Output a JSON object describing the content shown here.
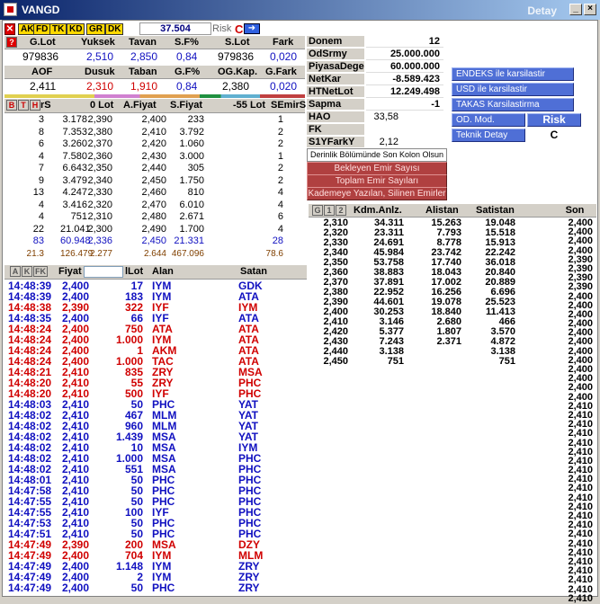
{
  "window": {
    "title": "VANGD",
    "subtitle": "Detay"
  },
  "toolbar": {
    "tags": [
      "AK",
      "FD",
      "TK",
      "KD",
      "GR",
      "DK"
    ],
    "price": "37.504",
    "risk_label": "Risk",
    "risk_value": "C"
  },
  "summary": {
    "h1": [
      "G.Lot",
      "Yuksek",
      "Tavan",
      "S.F%",
      "S.Lot",
      "Fark"
    ],
    "v1": [
      "979836",
      "2,510",
      "2,850",
      "0,84",
      "979836",
      "0,020"
    ],
    "h2": [
      "AOF",
      "Dusuk",
      "Taban",
      "G.F%",
      "OG.Kap.",
      "G.Fark"
    ],
    "v2": [
      "2,411",
      "2,310",
      "1,910",
      "0,84",
      "2,380",
      "0,020"
    ]
  },
  "depth": {
    "tabs": [
      "B",
      "T",
      "H"
    ],
    "headers": [
      "rS",
      "0 Lot",
      "A.Fiyat",
      "S.Fiyat",
      "-55 Lot",
      "SEmirS"
    ],
    "rows": [
      [
        "3",
        "3.178",
        "2,390",
        "2,400",
        "233",
        "1"
      ],
      [
        "8",
        "7.353",
        "2,380",
        "2,410",
        "3.792",
        "2"
      ],
      [
        "6",
        "3.260",
        "2,370",
        "2,420",
        "1.060",
        "2"
      ],
      [
        "4",
        "7.580",
        "2,360",
        "2,430",
        "3.000",
        "1"
      ],
      [
        "7",
        "6.643",
        "2,350",
        "2,440",
        "305",
        "2"
      ],
      [
        "9",
        "3.479",
        "2,340",
        "2,450",
        "1.750",
        "2"
      ],
      [
        "13",
        "4.247",
        "2,330",
        "2,460",
        "810",
        "4"
      ],
      [
        "4",
        "3.416",
        "2,320",
        "2,470",
        "6.010",
        "4"
      ],
      [
        "4",
        "751",
        "2,310",
        "2,480",
        "2.671",
        "6"
      ],
      [
        "22",
        "21.041",
        "2,300",
        "2,490",
        "1.700",
        "4"
      ]
    ],
    "total": [
      "83",
      "60.948",
      "2,336",
      "2,450",
      "21.331",
      "28"
    ],
    "avg": [
      "21.3",
      "126.479",
      "2.277",
      "2.644",
      "467.096",
      "78.6"
    ]
  },
  "trades": {
    "tabs": [
      "A",
      "K",
      "FK"
    ],
    "headers": [
      "Fiyat",
      "lLot",
      "Alan",
      "Satan"
    ],
    "rows": [
      [
        "14:48:39",
        "2,400",
        "17",
        "IYM",
        "GDK",
        "b"
      ],
      [
        "14:48:39",
        "2,400",
        "183",
        "IYM",
        "ATA",
        "b"
      ],
      [
        "14:48:38",
        "2,390",
        "322",
        "IYF",
        "IYM",
        "r"
      ],
      [
        "14:48:35",
        "2,400",
        "66",
        "IYF",
        "ATA",
        "b"
      ],
      [
        "14:48:24",
        "2,400",
        "750",
        "ATA",
        "ATA",
        "r"
      ],
      [
        "14:48:24",
        "2,400",
        "1.000",
        "IYM",
        "ATA",
        "r"
      ],
      [
        "14:48:24",
        "2,400",
        "1",
        "AKM",
        "ATA",
        "r"
      ],
      [
        "14:48:24",
        "2,400",
        "1.000",
        "TAC",
        "ATA",
        "r"
      ],
      [
        "14:48:21",
        "2,410",
        "835",
        "ZRY",
        "MSA",
        "r"
      ],
      [
        "14:48:20",
        "2,410",
        "55",
        "ZRY",
        "PHC",
        "r"
      ],
      [
        "14:48:20",
        "2,410",
        "500",
        "IYF",
        "PHC",
        "r"
      ],
      [
        "14:48:03",
        "2,410",
        "50",
        "PHC",
        "YAT",
        "b"
      ],
      [
        "14:48:02",
        "2,410",
        "467",
        "MLM",
        "YAT",
        "b"
      ],
      [
        "14:48:02",
        "2,410",
        "960",
        "MLM",
        "YAT",
        "b"
      ],
      [
        "14:48:02",
        "2,410",
        "1.439",
        "MSA",
        "YAT",
        "b"
      ],
      [
        "14:48:02",
        "2,410",
        "10",
        "MSA",
        "IYM",
        "b"
      ],
      [
        "14:48:02",
        "2,410",
        "1.000",
        "MSA",
        "PHC",
        "b"
      ],
      [
        "14:48:02",
        "2,410",
        "551",
        "MSA",
        "PHC",
        "b"
      ],
      [
        "14:48:01",
        "2,410",
        "50",
        "PHC",
        "PHC",
        "b"
      ],
      [
        "14:47:58",
        "2,410",
        "50",
        "PHC",
        "PHC",
        "b"
      ],
      [
        "14:47:55",
        "2,410",
        "50",
        "PHC",
        "PHC",
        "b"
      ],
      [
        "14:47:55",
        "2,410",
        "100",
        "IYF",
        "PHC",
        "b"
      ],
      [
        "14:47:53",
        "2,410",
        "50",
        "PHC",
        "PHC",
        "b"
      ],
      [
        "14:47:51",
        "2,410",
        "50",
        "PHC",
        "PHC",
        "b"
      ],
      [
        "14:47:49",
        "2,390",
        "200",
        "MSA",
        "DZY",
        "r"
      ],
      [
        "14:47:49",
        "2,400",
        "704",
        "IYM",
        "MLM",
        "r"
      ],
      [
        "14:47:49",
        "2,400",
        "1.148",
        "IYM",
        "ZRY",
        "b"
      ],
      [
        "14:47:49",
        "2,400",
        "2",
        "IYM",
        "ZRY",
        "b"
      ],
      [
        "14:47:49",
        "2,400",
        "50",
        "PHC",
        "ZRY",
        "b"
      ]
    ]
  },
  "info": {
    "rows": [
      [
        "Donem",
        "12"
      ],
      [
        "OdSrmy",
        "25.000.000"
      ],
      [
        "PiyasaDege",
        "60.000.000"
      ],
      [
        "NetKar",
        "-8.589.423"
      ],
      [
        "HTNetLot",
        "12.249.498"
      ],
      [
        "Sapma",
        "-1"
      ]
    ],
    "hao_label": "HAO",
    "hao_value": "33,58",
    "fk_label": "FK",
    "fk_value": "",
    "s1y_label": "S1YFarkY",
    "s1y_value": "2,12"
  },
  "actions": {
    "endeks": "ENDEKS ile karsilastir",
    "usd": "USD ile karsilastir",
    "takas": "TAKAS Karsilastirma",
    "od_mod": "OD. Mod.",
    "risk_kodu_label": "Risk Kodu",
    "teknik": "Teknik Detay",
    "risk_kodu_value": "C"
  },
  "options": {
    "depth_note": "Derinlik Bölümünde Son Kolon Olsun",
    "b1": "Bekleyen Emir Sayısı",
    "b2": "Toplam Emir Sayıları",
    "b3": "Kademeye Yazılan, Silinen Emirler"
  },
  "dist": {
    "tabs": [
      "G",
      "1",
      "2"
    ],
    "headers": [
      "Kdm.Anlz.",
      "Alistan",
      "Satistan",
      "Son"
    ],
    "rows": [
      [
        "2,310",
        "34.311",
        "15.263",
        "19.048"
      ],
      [
        "2,320",
        "23.311",
        "7.793",
        "15.518"
      ],
      [
        "2,330",
        "24.691",
        "8.778",
        "15.913"
      ],
      [
        "2,340",
        "45.984",
        "23.742",
        "22.242"
      ],
      [
        "2,350",
        "53.758",
        "17.740",
        "36.018"
      ],
      [
        "2,360",
        "38.883",
        "18.043",
        "20.840"
      ],
      [
        "2,370",
        "37.891",
        "17.002",
        "20.889"
      ],
      [
        "2,380",
        "22.952",
        "16.256",
        "6.696"
      ],
      [
        "2,390",
        "44.601",
        "19.078",
        "25.523"
      ],
      [
        "2,400",
        "30.253",
        "18.840",
        "11.413"
      ],
      [
        "2,410",
        "3.146",
        "2.680",
        "466"
      ],
      [
        "2,420",
        "5.377",
        "1.807",
        "3.570"
      ],
      [
        "2,430",
        "7.243",
        "2.371",
        "4.872"
      ],
      [
        "2,440",
        "3.138",
        "",
        "3.138"
      ],
      [
        "2,450",
        "751",
        "",
        "751"
      ]
    ],
    "son": [
      "2,400",
      "2,400",
      "2,400",
      "2,400",
      "2,390",
      "2,390",
      "2,390",
      "2,390",
      "2,400",
      "2,400",
      "2,400",
      "2,400",
      "2,400",
      "2,400",
      "2,400",
      "2,400",
      "2,400",
      "2,400",
      "2,400",
      "2,400",
      "2,410",
      "2,410",
      "2,410",
      "2,410",
      "2,410",
      "2,410",
      "2,410",
      "2,410",
      "2,410",
      "2,410",
      "2,410",
      "2,410",
      "2,410",
      "2,410",
      "2,410",
      "2,410",
      "2,410",
      "2,410",
      "2,410",
      "2,410",
      "2,410",
      "2,410"
    ]
  }
}
